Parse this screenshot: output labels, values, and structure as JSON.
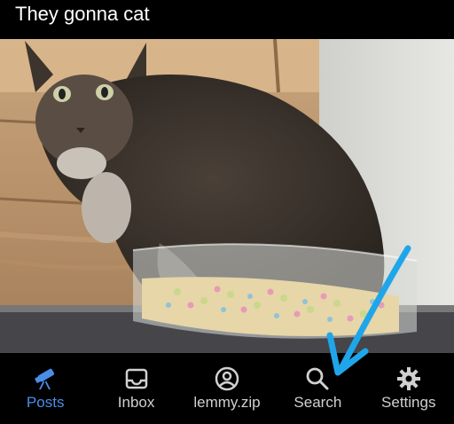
{
  "post": {
    "title": "They gonna cat"
  },
  "colors": {
    "accent": "#4a8de8",
    "annotation_arrow": "#1fa6ea"
  },
  "nav": {
    "items": [
      {
        "label": "Posts",
        "icon": "telescope-icon",
        "active": true
      },
      {
        "label": "Inbox",
        "icon": "inbox-icon",
        "active": false
      },
      {
        "label": "lemmy.zip",
        "icon": "account-icon",
        "active": false
      },
      {
        "label": "Search",
        "icon": "search-icon",
        "active": false
      },
      {
        "label": "Settings",
        "icon": "gear-icon",
        "active": false
      }
    ]
  }
}
